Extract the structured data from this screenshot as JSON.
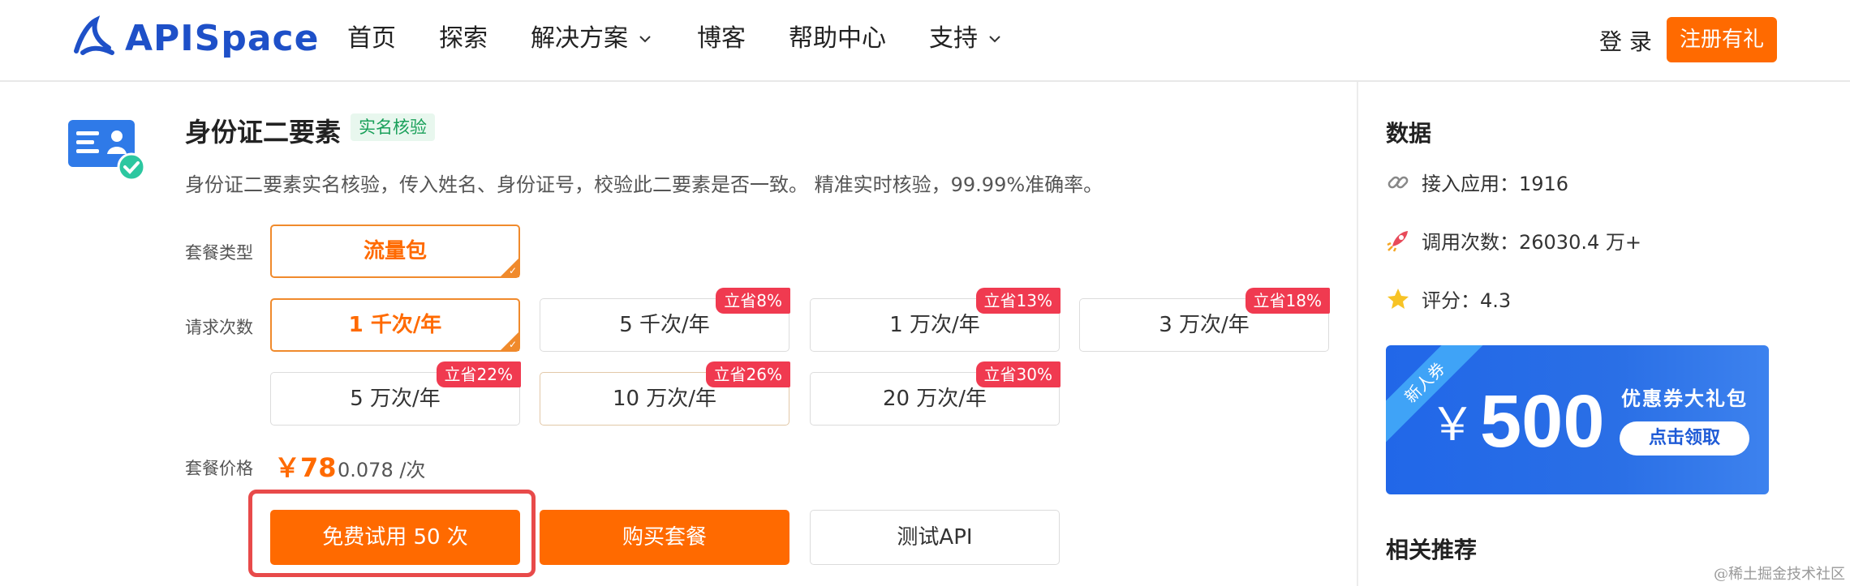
{
  "brand": {
    "name_part1": "API",
    "name_part2": "Space"
  },
  "nav": {
    "items": [
      {
        "label": "首页",
        "has_dropdown": false
      },
      {
        "label": "探索",
        "has_dropdown": false
      },
      {
        "label": "解决方案",
        "has_dropdown": true
      },
      {
        "label": "博客",
        "has_dropdown": false
      },
      {
        "label": "帮助中心",
        "has_dropdown": false
      },
      {
        "label": "支持",
        "has_dropdown": true
      }
    ],
    "login": "登 录",
    "register": "注册有礼"
  },
  "product": {
    "title": "身份证二要素",
    "tag": "实名核验",
    "description": "身份证二要素实名核验，传入姓名、身份证号，校验此二要素是否一致。 精准实时核验，99.99%准确率。"
  },
  "package": {
    "type_label": "套餐类型",
    "type_option": "流量包",
    "count_label": "请求次数",
    "count_options": [
      {
        "label": "1 千次/年",
        "badge": "",
        "state": "active"
      },
      {
        "label": "5 千次/年",
        "badge": "立省8%",
        "state": "normal"
      },
      {
        "label": "1 万次/年",
        "badge": "立省13%",
        "state": "normal"
      },
      {
        "label": "3 万次/年",
        "badge": "立省18%",
        "state": "normal"
      },
      {
        "label": "5 万次/年",
        "badge": "立省22%",
        "state": "normal"
      },
      {
        "label": "10 万次/年",
        "badge": "立省26%",
        "state": "hover"
      },
      {
        "label": "20 万次/年",
        "badge": "立省30%",
        "state": "normal"
      }
    ],
    "price_label": "套餐价格",
    "price": "￥78",
    "unit_price": "0.078 /次"
  },
  "actions": {
    "free_trial": "免费试用 50 次",
    "buy": "购买套餐",
    "test_api": "测试API"
  },
  "sidebar": {
    "data_title": "数据",
    "stats": [
      {
        "icon": "link-icon",
        "text": "接入应用：1916"
      },
      {
        "icon": "rocket-icon",
        "text": "调用次数：26030.4 万+"
      },
      {
        "icon": "star-icon",
        "text": "评分：4.3"
      }
    ],
    "coupon": {
      "ribbon": "新人券",
      "currency": "￥",
      "amount": "500",
      "label": "优惠券大礼包",
      "button": "点击领取"
    },
    "related_title": "相关推荐"
  },
  "watermark": "@稀土掘金技术社区",
  "colors": {
    "accent": "#ff6a00",
    "brand": "#1e50c8",
    "badge": "#f03a50",
    "tag_green": "#1aa05a"
  }
}
